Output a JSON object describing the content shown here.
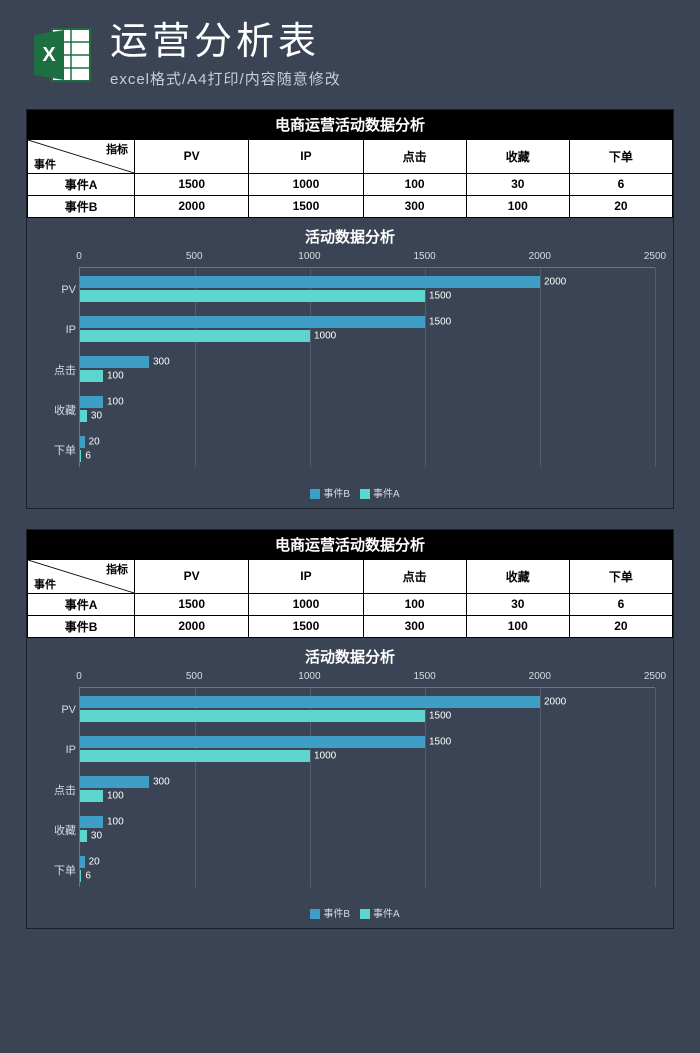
{
  "header": {
    "title": "运营分析表",
    "subtitle": "excel格式/A4打印/内容随意修改"
  },
  "sheet": {
    "title": "电商运营活动数据分析",
    "corner_top": "指标",
    "corner_left": "事件",
    "columns": [
      "PV",
      "IP",
      "点击",
      "收藏",
      "下单"
    ],
    "rows": [
      {
        "label": "事件A",
        "values": [
          1500,
          1000,
          100,
          30,
          6
        ]
      },
      {
        "label": "事件B",
        "values": [
          2000,
          1500,
          300,
          100,
          20
        ]
      }
    ]
  },
  "chart_data": {
    "type": "bar",
    "title": "活动数据分析",
    "orientation": "horizontal",
    "categories": [
      "PV",
      "IP",
      "点击",
      "收藏",
      "下单"
    ],
    "series": [
      {
        "name": "事件B",
        "values": [
          2000,
          1500,
          300,
          100,
          20
        ],
        "color": "#3e9ec6"
      },
      {
        "name": "事件A",
        "values": [
          1500,
          1000,
          100,
          30,
          6
        ],
        "color": "#5cd6cf"
      }
    ],
    "xlim": [
      0,
      2500
    ],
    "xticks": [
      0,
      500,
      1000,
      1500,
      2000,
      2500
    ],
    "legend": [
      "事件B",
      "事件A"
    ]
  }
}
